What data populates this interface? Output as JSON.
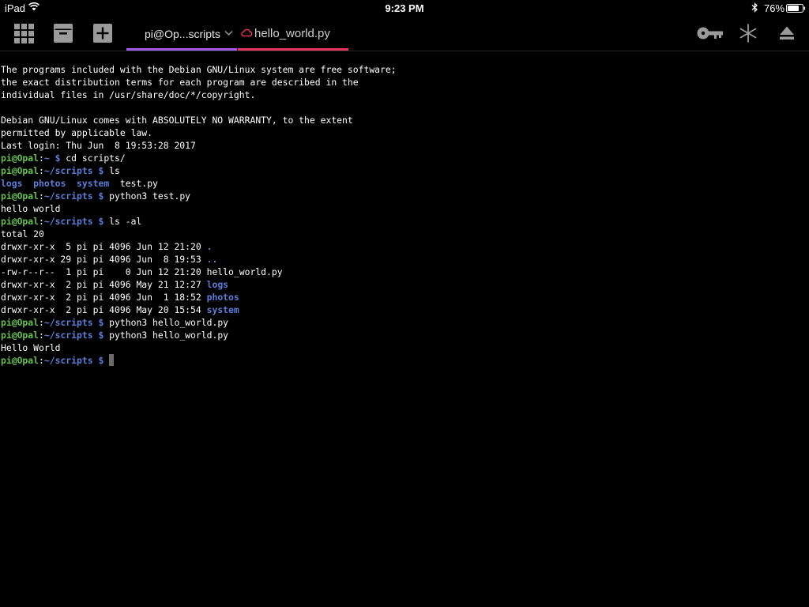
{
  "status_bar": {
    "device": "iPad",
    "time": "9:23 PM",
    "battery": "76%"
  },
  "toolbar": {
    "tabs": [
      {
        "label": "pi@Op...scripts",
        "active": true,
        "accent": "#a25cf0"
      },
      {
        "label": "hello_world.py",
        "active": false,
        "accent": "#e8355e"
      }
    ]
  },
  "terminal": {
    "colors": {
      "user": "#66c04a",
      "path": "#5b7fd8",
      "directory": "#5b7fd8",
      "text": "#ffffff"
    },
    "lines": [
      {
        "segments": [
          {
            "text": "The programs included with the Debian GNU/Linux system are free software;",
            "style": "plain"
          }
        ]
      },
      {
        "segments": [
          {
            "text": "the exact distribution terms for each program are described in the",
            "style": "plain"
          }
        ]
      },
      {
        "segments": [
          {
            "text": "individual files in /usr/share/doc/*/copyright.",
            "style": "plain"
          }
        ]
      },
      {
        "segments": [
          {
            "text": "",
            "style": "plain"
          }
        ]
      },
      {
        "segments": [
          {
            "text": "Debian GNU/Linux comes with ABSOLUTELY NO WARRANTY, to the extent",
            "style": "plain"
          }
        ]
      },
      {
        "segments": [
          {
            "text": "permitted by applicable law.",
            "style": "plain"
          }
        ]
      },
      {
        "segments": [
          {
            "text": "Last login: Thu Jun  8 19:53:28 2017",
            "style": "plain"
          }
        ]
      },
      {
        "segments": [
          {
            "text": "pi@Opal",
            "style": "user"
          },
          {
            "text": ":",
            "style": "plain"
          },
          {
            "text": "~ $",
            "style": "path"
          },
          {
            "text": " cd scripts/",
            "style": "plain"
          }
        ]
      },
      {
        "segments": [
          {
            "text": "pi@Opal",
            "style": "user"
          },
          {
            "text": ":",
            "style": "plain"
          },
          {
            "text": "~/scripts $",
            "style": "path"
          },
          {
            "text": " ls",
            "style": "plain"
          }
        ]
      },
      {
        "segments": [
          {
            "text": "logs",
            "style": "dir"
          },
          {
            "text": "  ",
            "style": "plain"
          },
          {
            "text": "photos",
            "style": "dir"
          },
          {
            "text": "  ",
            "style": "plain"
          },
          {
            "text": "system",
            "style": "dir"
          },
          {
            "text": "  test.py",
            "style": "plain"
          }
        ]
      },
      {
        "segments": [
          {
            "text": "pi@Opal",
            "style": "user"
          },
          {
            "text": ":",
            "style": "plain"
          },
          {
            "text": "~/scripts $",
            "style": "path"
          },
          {
            "text": " python3 test.py",
            "style": "plain"
          }
        ]
      },
      {
        "segments": [
          {
            "text": "hello world",
            "style": "plain"
          }
        ]
      },
      {
        "segments": [
          {
            "text": "pi@Opal",
            "style": "user"
          },
          {
            "text": ":",
            "style": "plain"
          },
          {
            "text": "~/scripts $",
            "style": "path"
          },
          {
            "text": " ls -al",
            "style": "plain"
          }
        ]
      },
      {
        "segments": [
          {
            "text": "total 20",
            "style": "plain"
          }
        ]
      },
      {
        "segments": [
          {
            "text": "drwxr-xr-x  5 pi pi 4096 Jun 12 21:20 ",
            "style": "plain"
          },
          {
            "text": ".",
            "style": "dir"
          }
        ]
      },
      {
        "segments": [
          {
            "text": "drwxr-xr-x 29 pi pi 4096 Jun  8 19:53 ",
            "style": "plain"
          },
          {
            "text": "..",
            "style": "dir"
          }
        ]
      },
      {
        "segments": [
          {
            "text": "-rw-r--r--  1 pi pi    0 Jun 12 21:20 hello_world.py",
            "style": "plain"
          }
        ]
      },
      {
        "segments": [
          {
            "text": "drwxr-xr-x  2 pi pi 4096 May 21 12:27 ",
            "style": "plain"
          },
          {
            "text": "logs",
            "style": "dir"
          }
        ]
      },
      {
        "segments": [
          {
            "text": "drwxr-xr-x  2 pi pi 4096 Jun  1 18:52 ",
            "style": "plain"
          },
          {
            "text": "photos",
            "style": "dir"
          }
        ]
      },
      {
        "segments": [
          {
            "text": "drwxr-xr-x  2 pi pi 4096 May 20 15:54 ",
            "style": "plain"
          },
          {
            "text": "system",
            "style": "dir"
          }
        ]
      },
      {
        "segments": [
          {
            "text": "pi@Opal",
            "style": "user"
          },
          {
            "text": ":",
            "style": "plain"
          },
          {
            "text": "~/scripts $",
            "style": "path"
          },
          {
            "text": " python3 hello_world.py",
            "style": "plain"
          }
        ]
      },
      {
        "segments": [
          {
            "text": "pi@Opal",
            "style": "user"
          },
          {
            "text": ":",
            "style": "plain"
          },
          {
            "text": "~/scripts $",
            "style": "path"
          },
          {
            "text": " python3 hello_world.py",
            "style": "plain"
          }
        ]
      },
      {
        "segments": [
          {
            "text": "Hello World",
            "style": "plain"
          }
        ]
      },
      {
        "segments": [
          {
            "text": "pi@Opal",
            "style": "user"
          },
          {
            "text": ":",
            "style": "plain"
          },
          {
            "text": "~/scripts $",
            "style": "path"
          },
          {
            "text": " ",
            "style": "plain"
          }
        ],
        "cursor": true
      }
    ]
  }
}
